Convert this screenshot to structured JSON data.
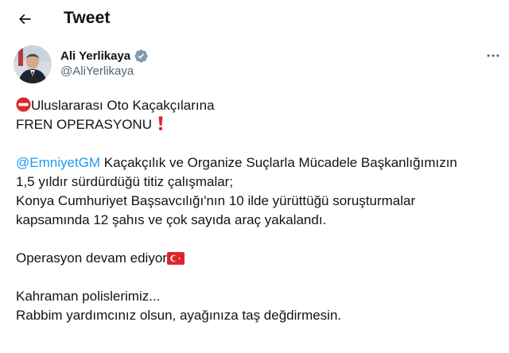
{
  "header": {
    "title": "Tweet"
  },
  "author": {
    "name": "Ali Yerlikaya",
    "handle": "@AliYerlikaya"
  },
  "tweet": {
    "line1": "Uluslararası Oto Kaçakçılarına",
    "line2": "FREN OPERASYONU",
    "mention": "@EmniyetGM",
    "line3_rest": " Kaçakçılık ve Organize Suçlarla Mücadele Başkanlığımızın",
    "line4": "1,5 yıldır sürdürdüğü titiz çalışmalar;",
    "line5": "Konya Cumhuriyet Başsavcılığı'nın 10 ilde yürüttüğü soruşturmalar",
    "line6": "kapsamında 12 şahıs ve çok sayıda araç yakalandı.",
    "line7": "Operasyon devam ediyor",
    "line8": "Kahraman polislerimiz...",
    "line9": "Rabbim yardımcınız olsun, ayağınıza taş değdirmesin."
  },
  "icons": {
    "back": "arrow-left-icon",
    "verified": "verified-badge-icon",
    "more": "more-horizontal-icon",
    "no_entry": "no-entry-emoji",
    "exclamation": "red-exclamation-emoji",
    "flag": "turkey-flag-emoji"
  },
  "colors": {
    "accent": "#1d9bf0",
    "text": "#0f1419",
    "muted": "#536471",
    "emoji_red": "#e0242c"
  }
}
